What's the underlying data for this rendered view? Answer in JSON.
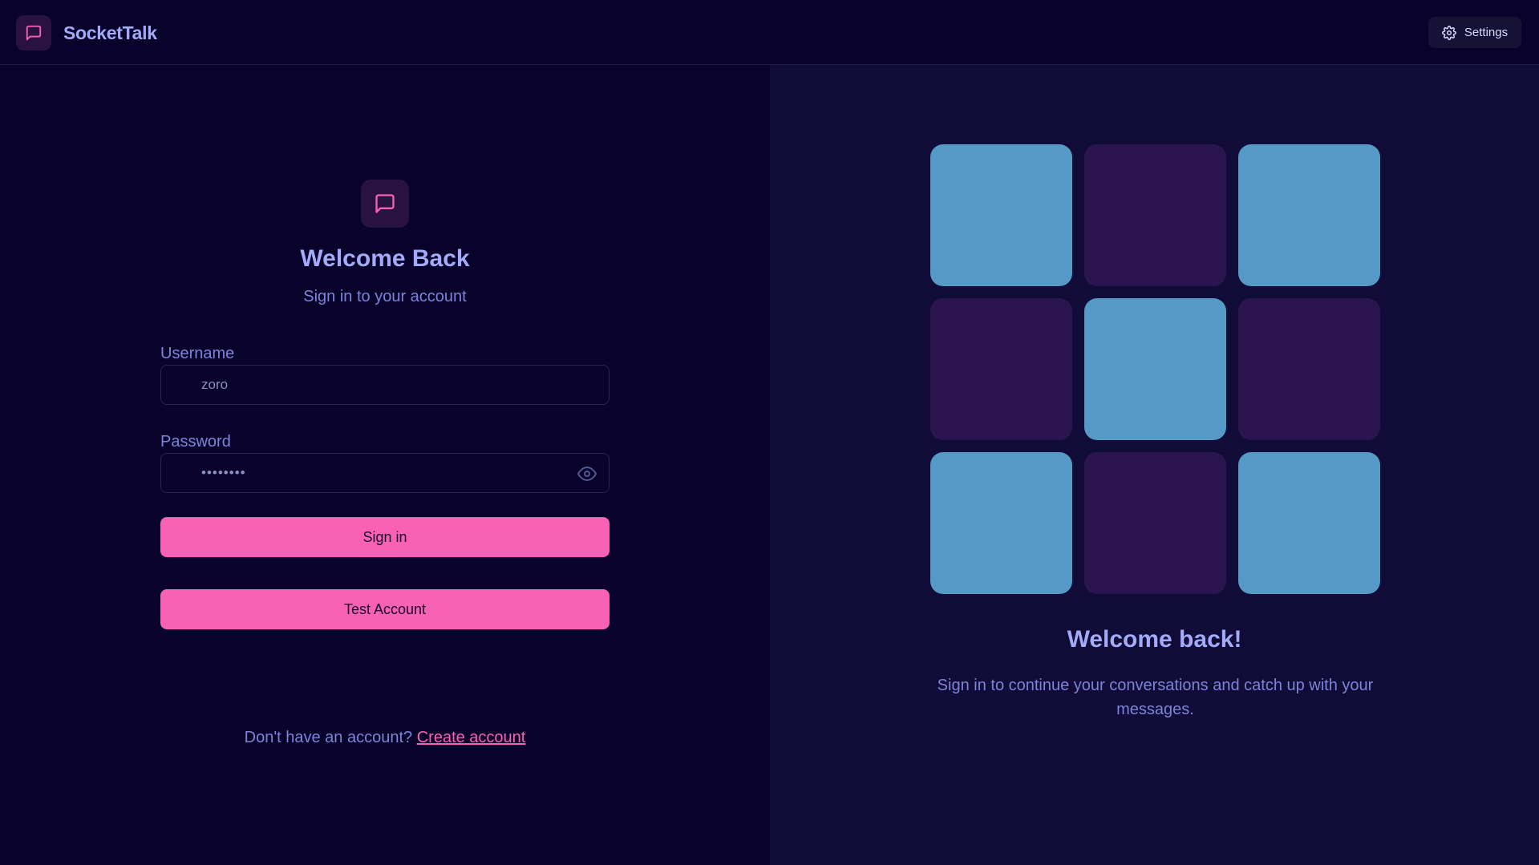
{
  "app": {
    "name": "SocketTalk",
    "settings_label": "Settings"
  },
  "login": {
    "title": "Welcome Back",
    "subtitle": "Sign in to your account",
    "username_label": "Username",
    "username_value": "zoro",
    "password_label": "Password",
    "password_value": "••••••••",
    "signin_label": "Sign in",
    "test_account_label": "Test Account",
    "no_account_text": "Don't have an account?",
    "create_account_label": "Create account"
  },
  "promo": {
    "title": "Welcome back!",
    "text": "Sign in to continue your conversations and catch up with your messages.",
    "tiles": [
      "on",
      "off",
      "on",
      "off",
      "on",
      "off",
      "on",
      "off",
      "on"
    ]
  },
  "colors": {
    "background": "#09032c",
    "panel": "#110b38",
    "accent_pink": "#f961b6",
    "accent_blue": "#5599c7",
    "tile_dark": "#2a1550",
    "text_heading": "#a3aaf8",
    "text_muted": "#7d84d8"
  },
  "icons": {
    "brand": "message-square-icon",
    "settings": "gear-icon",
    "username": "user-icon",
    "password": "lock-icon",
    "visibility": "eye-icon"
  }
}
